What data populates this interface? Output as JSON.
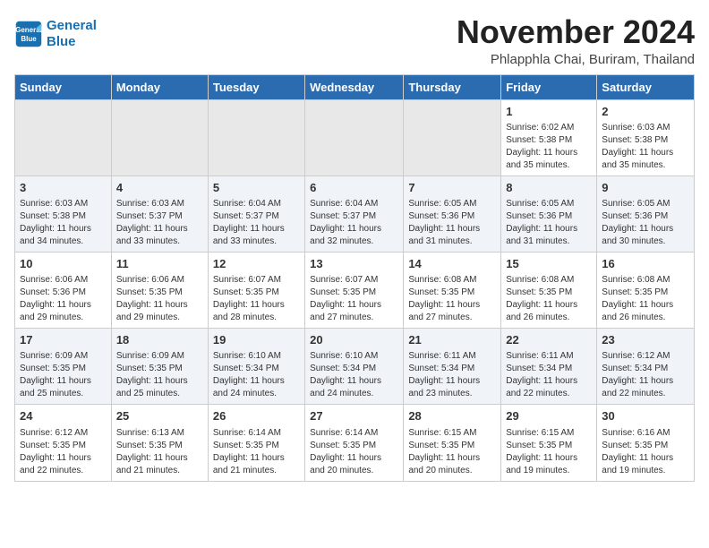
{
  "header": {
    "logo_line1": "General",
    "logo_line2": "Blue",
    "month_title": "November 2024",
    "subtitle": "Phlapphla Chai, Buriram, Thailand"
  },
  "days_of_week": [
    "Sunday",
    "Monday",
    "Tuesday",
    "Wednesday",
    "Thursday",
    "Friday",
    "Saturday"
  ],
  "weeks": [
    [
      {
        "day": "",
        "info": ""
      },
      {
        "day": "",
        "info": ""
      },
      {
        "day": "",
        "info": ""
      },
      {
        "day": "",
        "info": ""
      },
      {
        "day": "",
        "info": ""
      },
      {
        "day": "1",
        "info": "Sunrise: 6:02 AM\nSunset: 5:38 PM\nDaylight: 11 hours and 35 minutes."
      },
      {
        "day": "2",
        "info": "Sunrise: 6:03 AM\nSunset: 5:38 PM\nDaylight: 11 hours and 35 minutes."
      }
    ],
    [
      {
        "day": "3",
        "info": "Sunrise: 6:03 AM\nSunset: 5:38 PM\nDaylight: 11 hours and 34 minutes."
      },
      {
        "day": "4",
        "info": "Sunrise: 6:03 AM\nSunset: 5:37 PM\nDaylight: 11 hours and 33 minutes."
      },
      {
        "day": "5",
        "info": "Sunrise: 6:04 AM\nSunset: 5:37 PM\nDaylight: 11 hours and 33 minutes."
      },
      {
        "day": "6",
        "info": "Sunrise: 6:04 AM\nSunset: 5:37 PM\nDaylight: 11 hours and 32 minutes."
      },
      {
        "day": "7",
        "info": "Sunrise: 6:05 AM\nSunset: 5:36 PM\nDaylight: 11 hours and 31 minutes."
      },
      {
        "day": "8",
        "info": "Sunrise: 6:05 AM\nSunset: 5:36 PM\nDaylight: 11 hours and 31 minutes."
      },
      {
        "day": "9",
        "info": "Sunrise: 6:05 AM\nSunset: 5:36 PM\nDaylight: 11 hours and 30 minutes."
      }
    ],
    [
      {
        "day": "10",
        "info": "Sunrise: 6:06 AM\nSunset: 5:36 PM\nDaylight: 11 hours and 29 minutes."
      },
      {
        "day": "11",
        "info": "Sunrise: 6:06 AM\nSunset: 5:35 PM\nDaylight: 11 hours and 29 minutes."
      },
      {
        "day": "12",
        "info": "Sunrise: 6:07 AM\nSunset: 5:35 PM\nDaylight: 11 hours and 28 minutes."
      },
      {
        "day": "13",
        "info": "Sunrise: 6:07 AM\nSunset: 5:35 PM\nDaylight: 11 hours and 27 minutes."
      },
      {
        "day": "14",
        "info": "Sunrise: 6:08 AM\nSunset: 5:35 PM\nDaylight: 11 hours and 27 minutes."
      },
      {
        "day": "15",
        "info": "Sunrise: 6:08 AM\nSunset: 5:35 PM\nDaylight: 11 hours and 26 minutes."
      },
      {
        "day": "16",
        "info": "Sunrise: 6:08 AM\nSunset: 5:35 PM\nDaylight: 11 hours and 26 minutes."
      }
    ],
    [
      {
        "day": "17",
        "info": "Sunrise: 6:09 AM\nSunset: 5:35 PM\nDaylight: 11 hours and 25 minutes."
      },
      {
        "day": "18",
        "info": "Sunrise: 6:09 AM\nSunset: 5:35 PM\nDaylight: 11 hours and 25 minutes."
      },
      {
        "day": "19",
        "info": "Sunrise: 6:10 AM\nSunset: 5:34 PM\nDaylight: 11 hours and 24 minutes."
      },
      {
        "day": "20",
        "info": "Sunrise: 6:10 AM\nSunset: 5:34 PM\nDaylight: 11 hours and 24 minutes."
      },
      {
        "day": "21",
        "info": "Sunrise: 6:11 AM\nSunset: 5:34 PM\nDaylight: 11 hours and 23 minutes."
      },
      {
        "day": "22",
        "info": "Sunrise: 6:11 AM\nSunset: 5:34 PM\nDaylight: 11 hours and 22 minutes."
      },
      {
        "day": "23",
        "info": "Sunrise: 6:12 AM\nSunset: 5:34 PM\nDaylight: 11 hours and 22 minutes."
      }
    ],
    [
      {
        "day": "24",
        "info": "Sunrise: 6:12 AM\nSunset: 5:35 PM\nDaylight: 11 hours and 22 minutes."
      },
      {
        "day": "25",
        "info": "Sunrise: 6:13 AM\nSunset: 5:35 PM\nDaylight: 11 hours and 21 minutes."
      },
      {
        "day": "26",
        "info": "Sunrise: 6:14 AM\nSunset: 5:35 PM\nDaylight: 11 hours and 21 minutes."
      },
      {
        "day": "27",
        "info": "Sunrise: 6:14 AM\nSunset: 5:35 PM\nDaylight: 11 hours and 20 minutes."
      },
      {
        "day": "28",
        "info": "Sunrise: 6:15 AM\nSunset: 5:35 PM\nDaylight: 11 hours and 20 minutes."
      },
      {
        "day": "29",
        "info": "Sunrise: 6:15 AM\nSunset: 5:35 PM\nDaylight: 11 hours and 19 minutes."
      },
      {
        "day": "30",
        "info": "Sunrise: 6:16 AM\nSunset: 5:35 PM\nDaylight: 11 hours and 19 minutes."
      }
    ]
  ]
}
